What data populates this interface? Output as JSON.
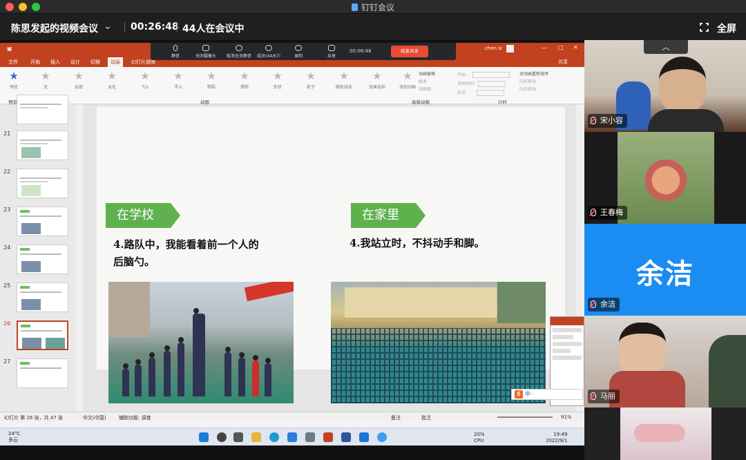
{
  "window": {
    "title": "钉钉会议"
  },
  "meeting": {
    "title": "陈思发起的视频会议",
    "duration": "00:26:48",
    "participants": "44人在会议中",
    "fullscreen_label": "全屏"
  },
  "share_toolbar": {
    "items": [
      "静音",
      "关闭摄像头",
      "取消全员静音",
      "成员(44/67)",
      "录制",
      "共享"
    ],
    "timer": "00:06:48",
    "stop_label": "结束共享"
  },
  "ppt": {
    "user": "chen si",
    "share": "共享",
    "tabs": [
      "文件",
      "开始",
      "插入",
      "设计",
      "切换",
      "动画",
      "幻灯片放映"
    ],
    "active_tab": "动画",
    "preview_label": "预览",
    "animations": [
      "无",
      "出现",
      "淡化",
      "飞入",
      "浮入",
      "劈裂",
      "擦除",
      "形状",
      "轮子",
      "随机线条",
      "效果选项"
    ],
    "advanced": [
      "添加动画",
      "动画窗格",
      "触发",
      "动画刷"
    ],
    "timing": [
      "开始:",
      "持续时间:",
      "延迟:",
      "对动画重新排序",
      "向前移动",
      "向后移动"
    ],
    "groups": {
      "preview": "预览",
      "animation": "动画",
      "advanced": "高级动画",
      "timing": "计时"
    },
    "slide_numbers": [
      "21",
      "22",
      "23",
      "24",
      "25",
      "26",
      "27"
    ],
    "status_left": "幻灯片 第 26 张，共 47 张",
    "status_lang": "中文(中国)",
    "status_access": "辅助功能: 调查",
    "status_notes": "备注",
    "status_comments": "批注",
    "zoom": "91%"
  },
  "slide": {
    "tag_left": "在学校",
    "text_left_1": "4.路队中，我能看着前一个人的",
    "text_left_2": "后脑勺。",
    "tag_right": "在家里",
    "text_right": "4.我站立时，不抖动手和脚。"
  },
  "taskbar": {
    "weather_temp": "24°C",
    "weather_desc": "多云",
    "lang_1": "20%",
    "lang_2": "CPU",
    "time": "19:49",
    "date": "2022/9/1"
  },
  "ime": {
    "text": "中 ·"
  },
  "participants": [
    {
      "name": "宋小容"
    },
    {
      "name": "王春梅"
    },
    {
      "name": "余洁",
      "avatar_text": "余洁",
      "avatar_color": "#1b8cf2"
    },
    {
      "name": "马丽"
    }
  ],
  "colors": {
    "ppt_red": "#c2421f",
    "tag_green": "#5fb14e",
    "end_red": "#e94b35"
  }
}
